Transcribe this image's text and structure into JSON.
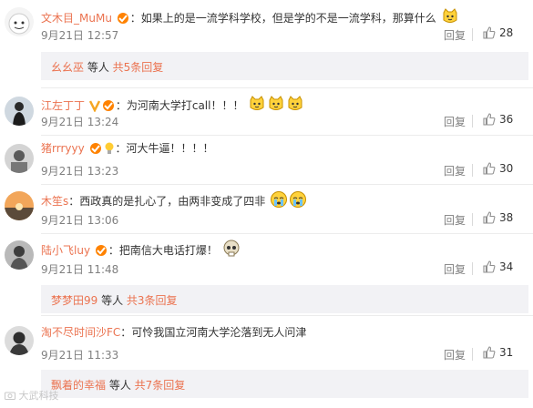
{
  "comments": [
    {
      "username": "文木目_MuMu",
      "text": "如果上的是一流学科学校，但是学的不是一流学科，那算什么",
      "emoji_count": 1,
      "time": "9月21日 12:57",
      "reply_label": "回复",
      "likes": "28",
      "sub_replies": {
        "users": "幺幺巫",
        "suffix": " 等人 ",
        "link": "共5条回复"
      }
    },
    {
      "username": "江左丁丁",
      "text": "为河南大学打call！！！",
      "emoji_count": 3,
      "time": "9月21日 13:24",
      "reply_label": "回复",
      "likes": "36"
    },
    {
      "username": "猪rrryyy",
      "text": "河大牛逼！！！！",
      "emoji_count": 0,
      "time": "9月21日 13:23",
      "reply_label": "回复",
      "likes": "30"
    },
    {
      "username": "木笙s",
      "text": "西政真的是扎心了，由两非变成了四非",
      "emoji_count": 2,
      "time": "9月21日 13:06",
      "reply_label": "回复",
      "likes": "38"
    },
    {
      "username": "陆小飞luy",
      "text": "把南信大电话打爆！",
      "emoji_count": 1,
      "time": "9月21日 11:48",
      "reply_label": "回复",
      "likes": "34",
      "sub_replies": {
        "users": "梦梦田99",
        "suffix": " 等人 ",
        "link": "共3条回复"
      }
    },
    {
      "username": "淘不尽时间沙FC",
      "text": "可怜我国立河南大学沦落到无人问津",
      "emoji_count": 0,
      "time": "9月21日 11:33",
      "reply_label": "回复",
      "likes": "31",
      "sub_replies": {
        "users": "飘着的幸福",
        "suffix": " 等人 ",
        "link": "共7条回复"
      }
    }
  ],
  "colors": {
    "username": "#eb7350",
    "meta": "#808080",
    "subbox": "#f2f2f5"
  },
  "icons": {
    "like": "thumbs-up-icon",
    "emoji": "cat-face-emoji",
    "badge": "vip-badge-icon"
  },
  "watermark": "大武科技"
}
